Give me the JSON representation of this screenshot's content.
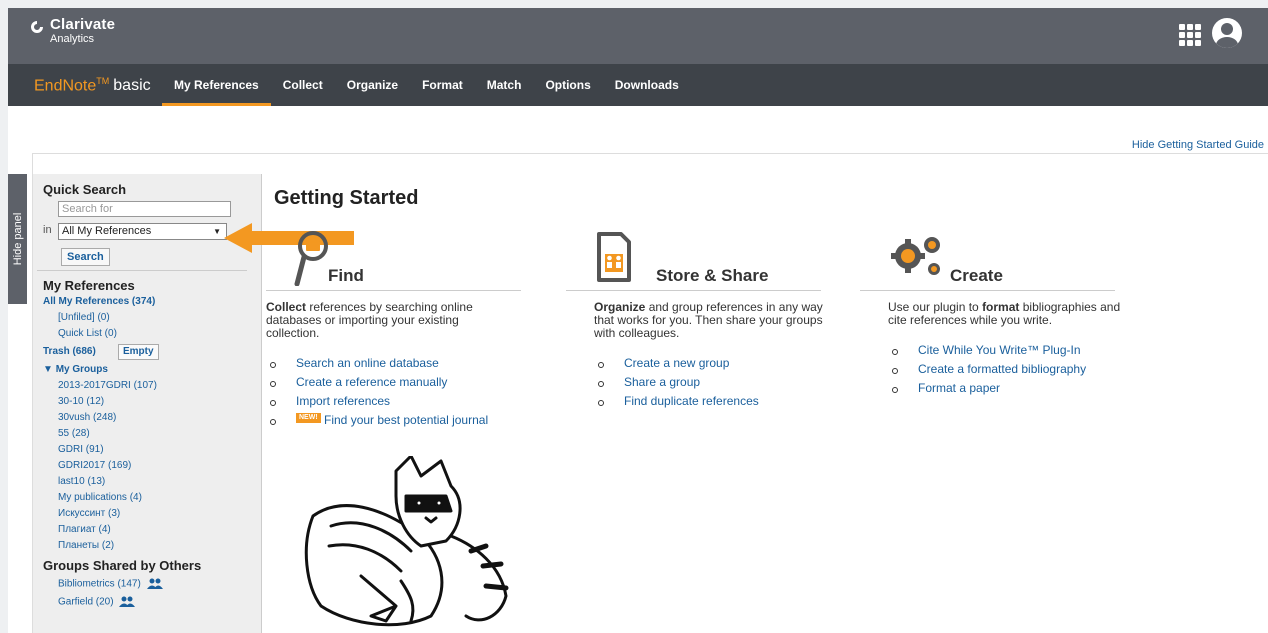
{
  "topbar": {
    "logo_line1": "Clarivate",
    "logo_line2": "Analytics",
    "icons": [
      "apps-grid-icon",
      "user-avatar-icon"
    ]
  },
  "nav": {
    "brand_prefix": "EndNote",
    "brand_tm": "TM",
    "brand_suffix": "basic",
    "items": [
      "My References",
      "Collect",
      "Organize",
      "Format",
      "Match",
      "Options",
      "Downloads"
    ],
    "active": "My References"
  },
  "hide_guide": "Hide Getting Started Guide",
  "hide_panel": "Hide panel",
  "quick_search": {
    "title": "Quick Search",
    "placeholder": "Search for",
    "in_label": "in",
    "select_value": "All My References",
    "button": "Search"
  },
  "sidebar": {
    "my_references_title": "My References",
    "all_refs": "All My References (374)",
    "unfiled": "[Unfiled] (0)",
    "quick_list": "Quick List (0)",
    "trash": "Trash (686)",
    "empty_btn": "Empty",
    "my_groups_title": "My Groups",
    "groups": [
      "2013-2017GDRI (107)",
      "30-10 (12)",
      "30vush (248)",
      "55 (28)",
      "GDRI (91)",
      "GDRI2017 (169)",
      "last10 (13)",
      "My publications (4)",
      "Искуссинт (3)",
      "Плагиат (4)",
      "Планеты (2)"
    ],
    "shared_title": "Groups Shared by Others",
    "shared_groups": [
      "Bibliometrics (147)",
      "Garfield (20)"
    ]
  },
  "main": {
    "title": "Getting Started",
    "columns": [
      {
        "icon": "magnifier-briefcase-icon",
        "title": "Find",
        "desc_bold": "Collect",
        "desc_rest": " references by searching online databases or importing your existing collection.",
        "links": [
          "Search an online database",
          "Create a reference manually",
          "Import references",
          "Find your best potential journal"
        ],
        "new_badge": "NEW!"
      },
      {
        "icon": "document-share-icon",
        "title": "Store & Share",
        "desc_bold": "Organize",
        "desc_rest": " and group references in any way that works for you. Then share your groups with colleagues.",
        "links": [
          "Create a new group",
          "Share a group",
          "Find duplicate references"
        ]
      },
      {
        "icon": "gears-icon",
        "title": "Create",
        "desc_pre": "Use our plugin to ",
        "desc_bold": "format",
        "desc_rest": " bibliographies and cite references while you write.",
        "links": [
          "Cite While You Write™ Plug-In",
          "Create a formatted bibliography",
          "Format a paper"
        ]
      }
    ]
  },
  "colors": {
    "topbar": "#5d6169",
    "navbar": "#3e4349",
    "accent": "#f39821",
    "link": "#1a5f9c"
  }
}
